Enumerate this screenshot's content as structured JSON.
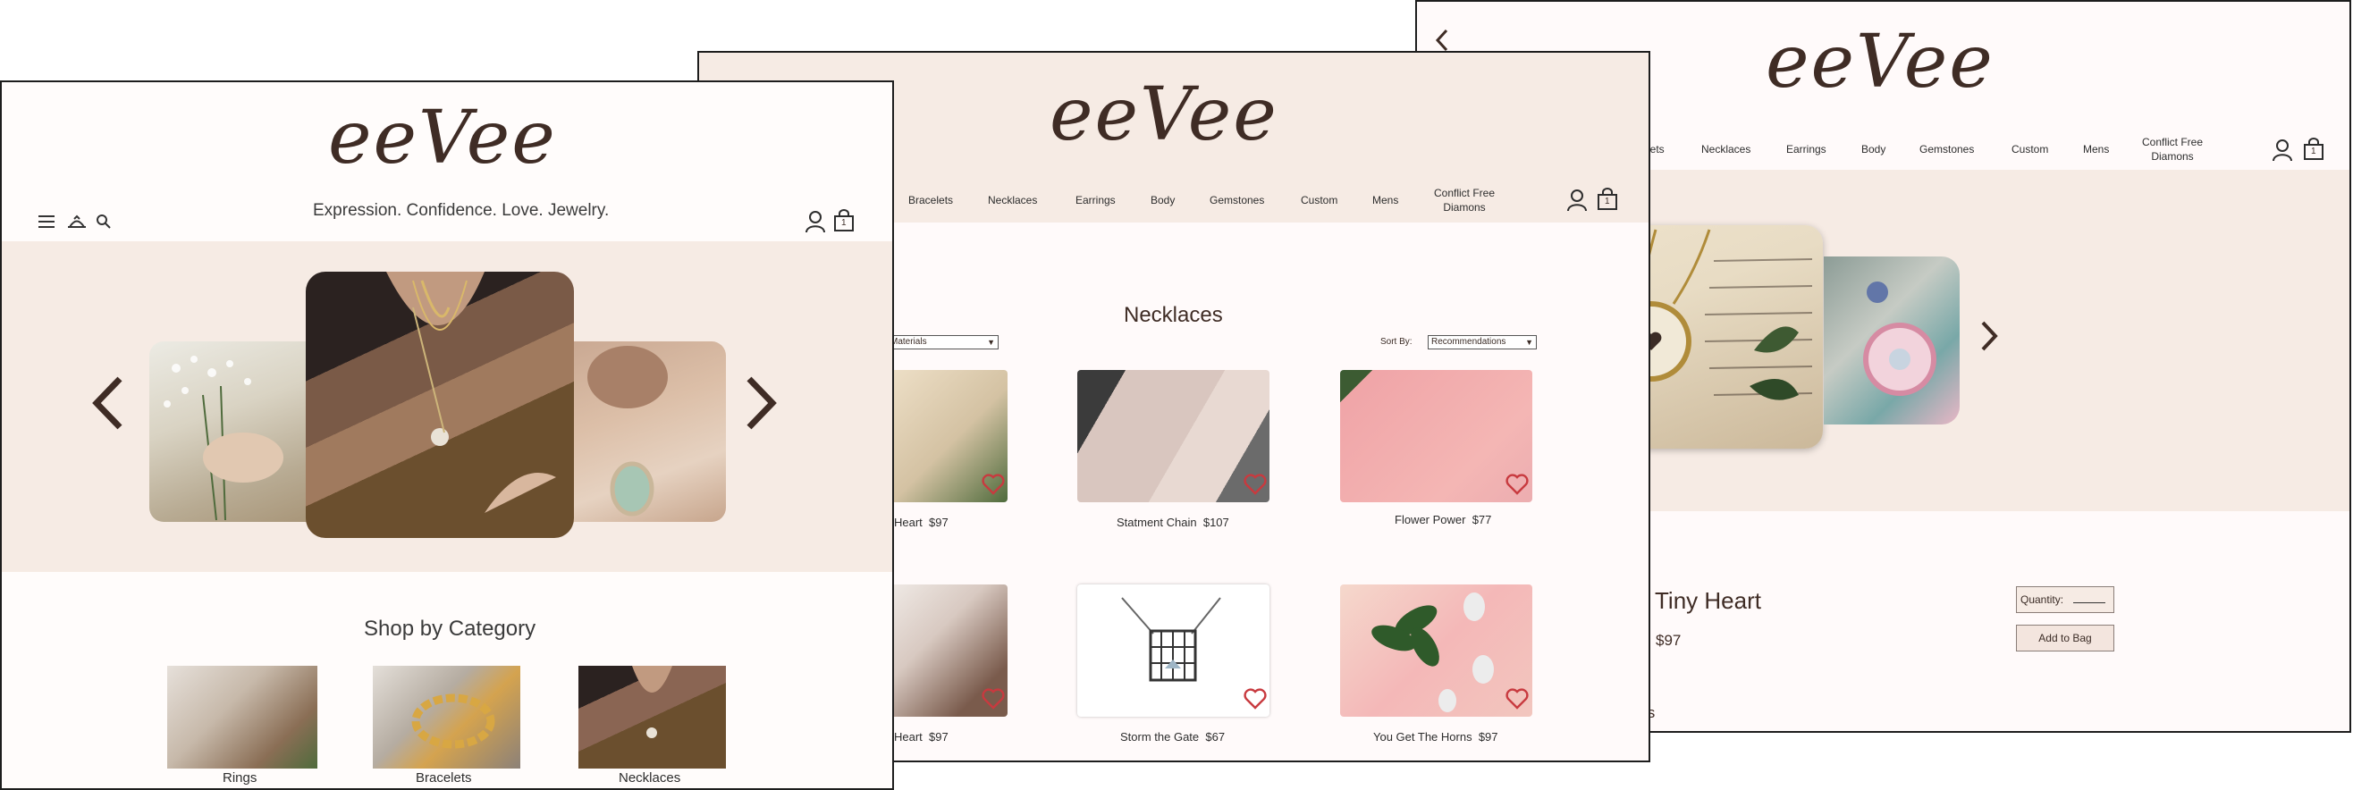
{
  "brand": {
    "logo_text": "eeVee",
    "tagline": "Expression. Confidence. Love. Jewelry."
  },
  "colors": {
    "accent": "#3f2c25",
    "band": "#f6ebe4",
    "heart": "#c83a3f",
    "button": "#f3e5de"
  },
  "nav": {
    "bracelets": "Bracelets",
    "necklaces": "Necklaces",
    "earrings": "Earrings",
    "body": "Body",
    "gemstones": "Gemstones",
    "custom": "Custom",
    "mens": "Mens",
    "conflict_free_line1": "Conflict Free",
    "conflict_free_line2": "Diamons",
    "right_partial": "lets"
  },
  "home": {
    "section_title": "Shop by Category",
    "categories": [
      {
        "label": "Rings"
      },
      {
        "label": "Bracelets"
      },
      {
        "label": "Necklaces"
      }
    ],
    "cart_count": "1"
  },
  "listing": {
    "title": "Necklaces",
    "filter_value": "Materials",
    "sort_label": "Sort By:",
    "sort_value": "Recommendations",
    "cart_count": "1",
    "products": [
      {
        "name": "Heart",
        "price": "$97"
      },
      {
        "name": "Statment Chain",
        "price": "$107"
      },
      {
        "name": "Flower Power",
        "price": "$77"
      },
      {
        "name": "Heart",
        "price": "$97"
      },
      {
        "name": "Storm the Gate",
        "price": "$67"
      },
      {
        "name": "You Get The Horns",
        "price": "$97"
      }
    ]
  },
  "detail": {
    "product_name": "Tiny Heart",
    "price": "$97",
    "quantity_label": "Quantity:",
    "add_to_bag": "Add to Bag",
    "partial_text": "ls",
    "cart_count": "1"
  }
}
